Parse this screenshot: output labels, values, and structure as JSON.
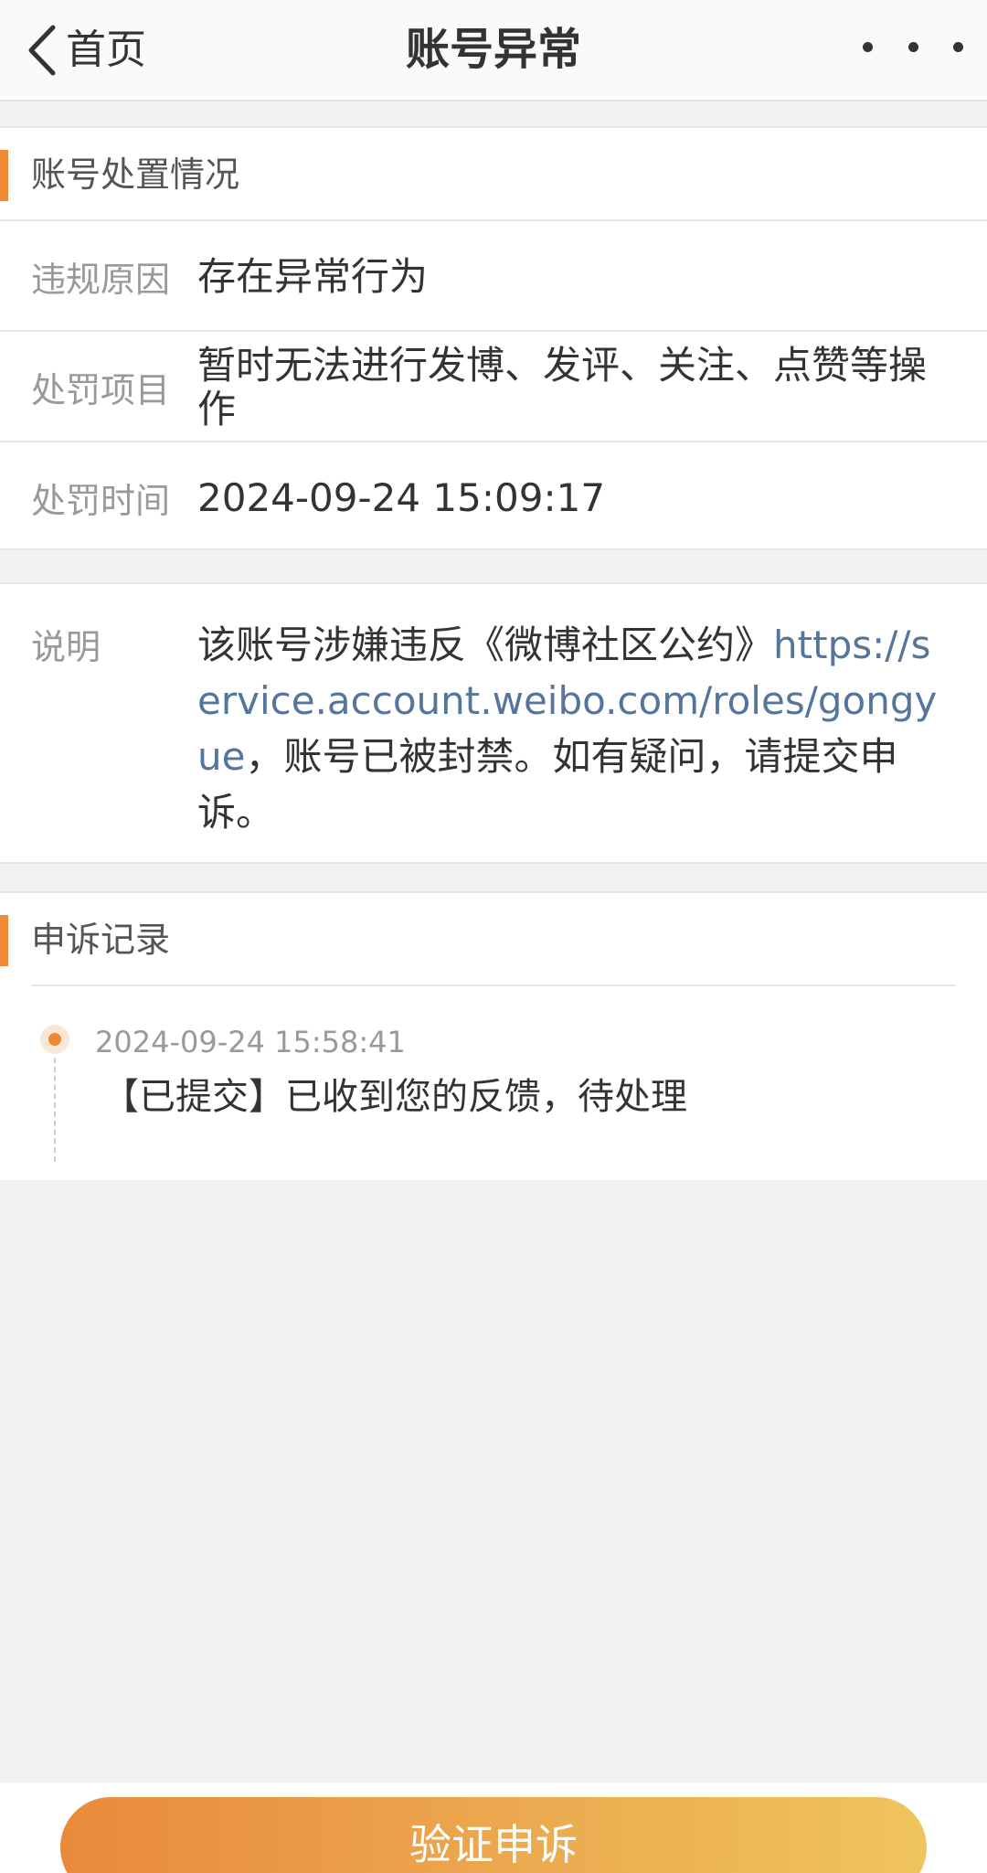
{
  "nav": {
    "back_label": "首页",
    "title": "账号异常"
  },
  "status_section": {
    "title": "账号处置情况",
    "rows": [
      {
        "label": "违规原因",
        "value": "存在异常行为"
      },
      {
        "label": "处罚项目",
        "value": "暂时无法进行发博、发评、关注、点赞等操作"
      },
      {
        "label": "处罚时间",
        "value": "2024-09-24 15:09:17"
      }
    ]
  },
  "description": {
    "label": "说明",
    "text_before": "该账号涉嫌违反《微博社区公约》",
    "link": "https://service.account.weibo.com/roles/gongyue",
    "text_after": "，账号已被封禁。如有疑问，请提交申诉。"
  },
  "appeal_section": {
    "title": "申诉记录",
    "records": [
      {
        "time": "2024-09-24 15:58:41",
        "text": "【已提交】已收到您的反馈，待处理"
      }
    ]
  },
  "bottom": {
    "button_label": "验证申诉"
  },
  "colors": {
    "accent": "#ee8a36",
    "link": "#55759c",
    "button_gradient_start": "#e98a3b",
    "button_gradient_end": "#efc45d"
  },
  "icons": {
    "back": "chevron-left-icon",
    "more": "more-horizontal-icon"
  }
}
